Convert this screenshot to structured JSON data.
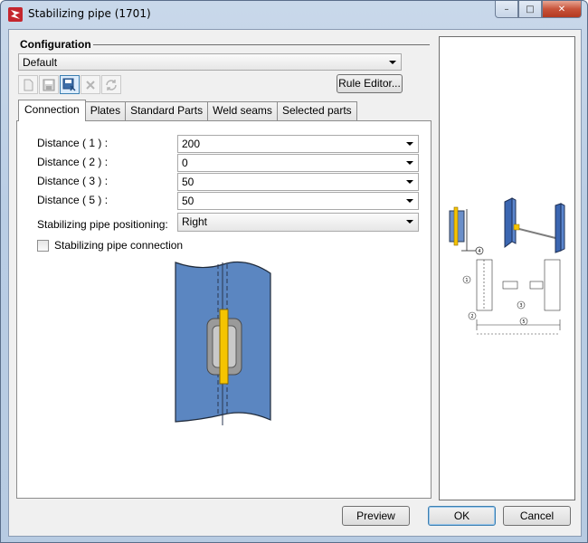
{
  "window": {
    "title": "Stabilizing pipe (1701)",
    "caption_buttons": {
      "minimize": "–",
      "maximize": "□",
      "close": "✕"
    }
  },
  "configuration": {
    "label": "Configuration",
    "selected": "Default",
    "rule_editor_label": "Rule Editor...",
    "toolbar_icons": [
      "new-icon",
      "save-icon",
      "save-as-icon",
      "delete-icon",
      "refresh-icon"
    ]
  },
  "tabs": [
    {
      "label": "Connection",
      "selected": true
    },
    {
      "label": "Plates",
      "selected": false
    },
    {
      "label": "Standard Parts",
      "selected": false
    },
    {
      "label": "Weld seams",
      "selected": false
    },
    {
      "label": "Selected parts",
      "selected": false
    }
  ],
  "connection": {
    "fields": [
      {
        "label": "Distance ( 1 ) :",
        "value": "200"
      },
      {
        "label": "Distance ( 2 ) :",
        "value": "0"
      },
      {
        "label": "Distance ( 3 ) :",
        "value": "50"
      },
      {
        "label": "Distance ( 5 ) :",
        "value": "50"
      }
    ],
    "positioning": {
      "label": "Stabilizing pipe positioning:",
      "value": "Right"
    },
    "checkbox": {
      "label": "Stabilizing pipe connection",
      "checked": false
    }
  },
  "preview": {
    "callouts": [
      "4",
      "1",
      "2",
      "3",
      "5"
    ]
  },
  "buttons": {
    "preview": "Preview",
    "ok": "OK",
    "cancel": "Cancel"
  },
  "colors": {
    "steel_blue": "#5b86c1",
    "pipe_yellow": "#f5c400",
    "window_frame": "#b9cde4"
  }
}
